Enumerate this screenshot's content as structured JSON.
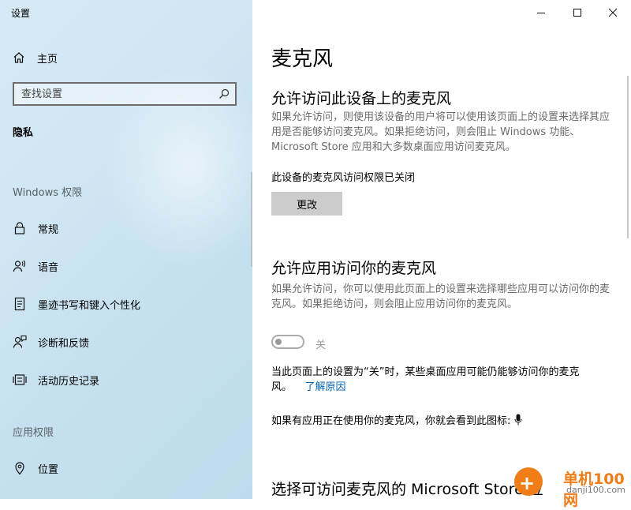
{
  "app": {
    "title": "设置"
  },
  "sidebar": {
    "home_label": "主页",
    "search_placeholder": "查找设置",
    "current_section": "隐私",
    "groups": [
      {
        "label": "Windows 权限"
      },
      {
        "label": "应用权限"
      }
    ],
    "items": [
      {
        "label": "常规",
        "icon": "lock-icon"
      },
      {
        "label": "语音",
        "icon": "speech-icon"
      },
      {
        "label": "墨迹书写和键入个性化",
        "icon": "inking-icon"
      },
      {
        "label": "诊断和反馈",
        "icon": "feedback-icon"
      },
      {
        "label": "活动历史记录",
        "icon": "activity-history-icon"
      },
      {
        "label": "位置",
        "icon": "location-icon"
      }
    ]
  },
  "window_controls": {
    "minimize": "minimize-icon",
    "maximize": "maximize-icon",
    "close": "close-icon"
  },
  "main": {
    "title": "麦克风",
    "section1": {
      "heading": "允许访问此设备上的麦克风",
      "description": "如果允许访问，则使用该设备的用户将可以使用该页面上的设置来选择其应用是否能够访问麦克风。如果拒绝访问，则会阻止 Windows 功能、Microsoft Store 应用和大多数桌面应用访问麦克风。",
      "status": "此设备的麦克风访问权限已关闭",
      "change_button": "更改"
    },
    "section2": {
      "heading": "允许应用访问你的麦克风",
      "description": "如果允许访问，你可以使用此页面上的设置来选择哪些应用可以访问你的麦克风。如果拒绝访问，则会阻止应用访问你的麦克风。",
      "toggle_state": "关",
      "toggle_on": false,
      "note": "当此页面上的设置为“关”时，某些桌面应用可能仍能够访问你的麦克风。",
      "learn_more": "了解原因",
      "icon_note": "如果有应用正在使用你的麦克风，你就会看到此图标:"
    },
    "section3": {
      "heading": "选择可访问麦克风的 Microsoft Store 应"
    }
  },
  "watermark": {
    "site": "单机100网",
    "url": "danji100.com"
  },
  "colors": {
    "accent": "#0063b1",
    "watermark": "#f07d18",
    "button_bg": "#cccccc"
  }
}
